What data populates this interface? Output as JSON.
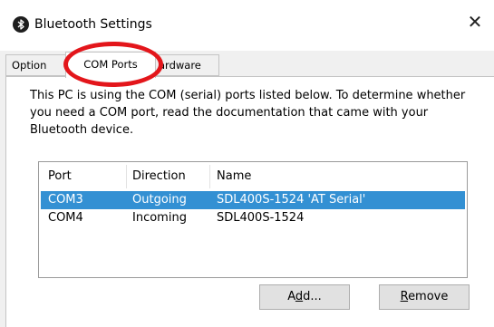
{
  "window": {
    "title": "Bluetooth Settings",
    "close_glyph": "✕",
    "app_icon": "bluetooth-icon"
  },
  "tabs": [
    {
      "label": "Options",
      "shown": "Option",
      "active": false
    },
    {
      "label": "COM Ports",
      "shown": "COM Ports",
      "active": true
    },
    {
      "label": "Hardware",
      "shown": "ardware",
      "active": false
    }
  ],
  "annotation": {
    "shape": "oval",
    "color": "#e3161b",
    "target": "COM Ports tab"
  },
  "description": "This PC is using the COM (serial) ports listed below. To determine whether you need a COM port, read the documentation that came with your Bluetooth device.",
  "list": {
    "columns": [
      "Port",
      "Direction",
      "Name"
    ],
    "rows": [
      {
        "port": "COM3",
        "direction": "Outgoing",
        "name": "SDL400S-1524 'AT Serial'",
        "selected": true
      },
      {
        "port": "COM4",
        "direction": "Incoming",
        "name": "SDL400S-1524",
        "selected": false
      }
    ]
  },
  "buttons": {
    "add": "Add...",
    "remove": "Remove"
  },
  "colors": {
    "selection": "#3390d3",
    "highlight": "#e3161b"
  }
}
